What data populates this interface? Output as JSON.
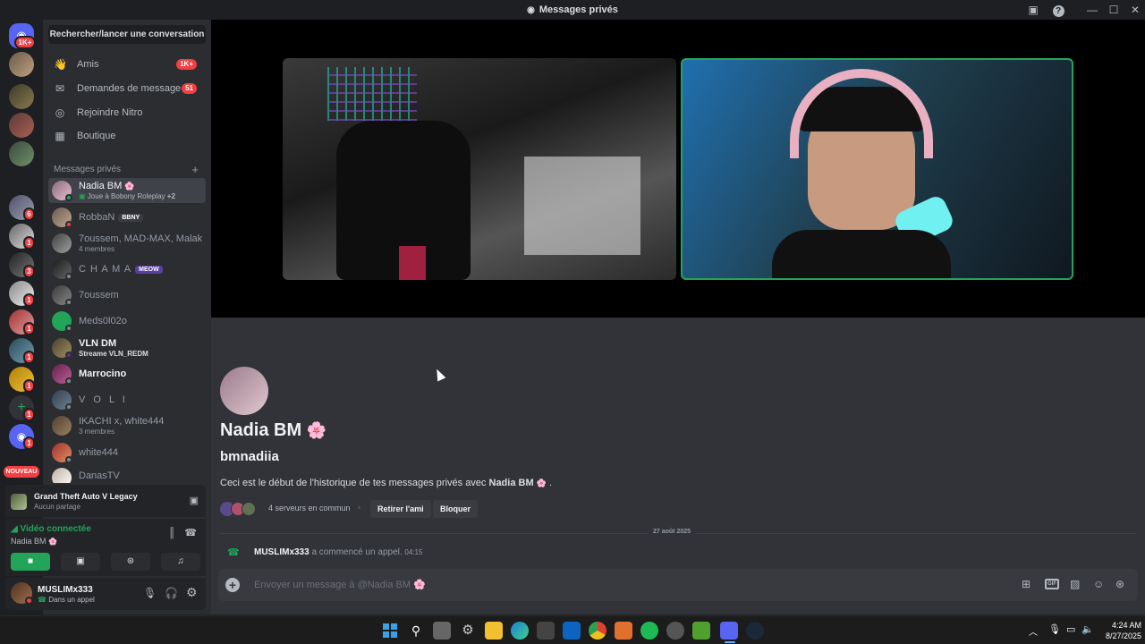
{
  "window": {
    "title": "Messages privés"
  },
  "rail": {
    "home_badge": "1K+",
    "new_label": "NOUVEAU",
    "badges": [
      "6",
      "1",
      "3",
      "1",
      "1",
      "1",
      "1",
      "1",
      "1"
    ]
  },
  "sidebar": {
    "search_label": "Rechercher/lancer une conversation",
    "nav": [
      {
        "label": "Amis",
        "badge": "1K+"
      },
      {
        "label": "Demandes de message",
        "badge": "51"
      },
      {
        "label": "Rejoindre Nitro"
      },
      {
        "label": "Boutique"
      }
    ],
    "dm_header": "Messages privés",
    "dms": [
      {
        "name": "Nadia BM",
        "emoji": "🌸",
        "sub": "Joue à Bobony Roleplay",
        "sub_extra": "+2"
      },
      {
        "name": "RobbaN",
        "tag": "BBNY"
      },
      {
        "name": "7oussem, MAD-MAX, Malak",
        "sub": "4 membres"
      },
      {
        "name": "C H A M A",
        "tag": "MEOW"
      },
      {
        "name": "7oussem"
      },
      {
        "name": "Meds0l02o"
      },
      {
        "name": "VLN DM",
        "sub": "Streame VLN_REDM"
      },
      {
        "name": "Marrocino"
      },
      {
        "name": "V O L I"
      },
      {
        "name": "IKACHI x, white444",
        "sub": "3 membres"
      },
      {
        "name": "white444"
      },
      {
        "name": "DanasTV"
      }
    ],
    "activity": {
      "game": "Grand Theft Auto V Legacy",
      "status": "Aucun partage"
    },
    "voice": {
      "status": "Vidéo connectée",
      "channel": "Nadia BM"
    },
    "user": {
      "name": "MUSLIMx333",
      "status": "Dans un appel"
    }
  },
  "profile": {
    "display_name": "Nadia BM",
    "username": "bmnadiia",
    "intro_prefix": "Ceci est le début de l'historique de tes messages privés avec",
    "intro_name": "Nadia BM",
    "mutual": "4 serveurs en commun",
    "remove_friend": "Retirer l'ami",
    "block": "Bloquer"
  },
  "chat": {
    "date_divider": "27 août 2025",
    "system_user": "MUSLIMx333",
    "system_text": "a commencé un appel.",
    "system_time": "04:15",
    "input_placeholder": "Envoyer un message à @Nadia BM 🌸"
  },
  "taskbar": {
    "time": "4:24 AM",
    "date": "8/27/2025"
  }
}
